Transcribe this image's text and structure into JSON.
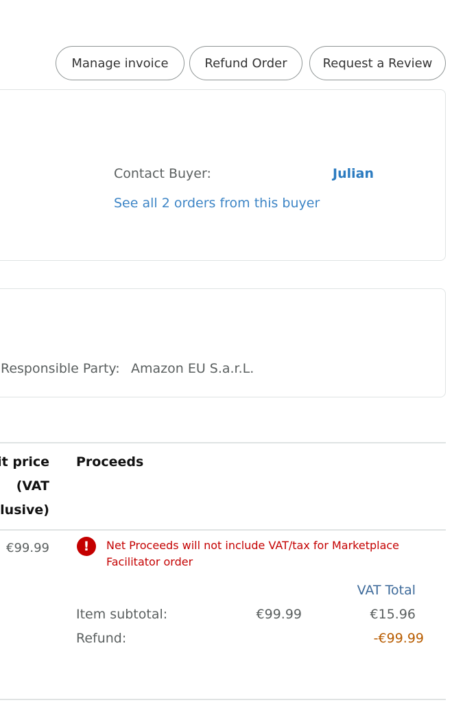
{
  "actions": {
    "manage_invoice": "Manage invoice",
    "refund_order": "Refund Order",
    "request_review": "Request a Review"
  },
  "buyer": {
    "contact_label": "Contact Buyer:",
    "contact_name": "Julian",
    "orders_link": "See all 2 orders from this buyer"
  },
  "tax": {
    "responsible_party_label": "Responsible Party:",
    "responsible_party_value": "Amazon EU S.a.r.L."
  },
  "table": {
    "headers": {
      "unit_price": [
        "it price",
        "(VAT",
        "clusive)"
      ],
      "proceeds": "Proceeds"
    },
    "row": {
      "unit_price": "€99.99",
      "alert_text": "Net Proceeds will not include VAT/tax for Marketplace Facilitator order",
      "vat_total_label": "VAT Total",
      "item_subtotal_label": "Item subtotal:",
      "item_subtotal_value": "€99.99",
      "item_subtotal_vat": "€15.96",
      "refund_label": "Refund:",
      "refund_value": "-€99.99"
    }
  },
  "colors": {
    "link": "#3d85c6",
    "alert": "#c40000",
    "refund": "#b85c00"
  }
}
